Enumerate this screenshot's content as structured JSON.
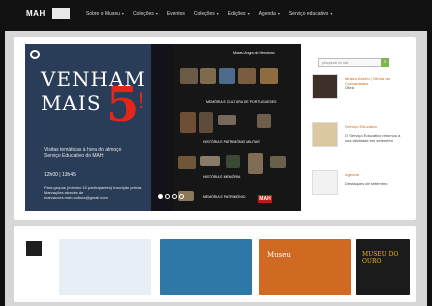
{
  "header": {
    "logo_text": "MAH",
    "nav": [
      {
        "label": "Sobre o Museu",
        "has_menu": true
      },
      {
        "label": "Coleções",
        "has_menu": true
      },
      {
        "label": "Eventos",
        "has_menu": false
      },
      {
        "label": "Coleções",
        "has_menu": true
      },
      {
        "label": "Edições",
        "has_menu": true
      },
      {
        "label": "Agenda",
        "has_menu": true
      },
      {
        "label": "Serviço educativo",
        "has_menu": true
      }
    ]
  },
  "hero": {
    "header_text": "Museu Angra do Heroísmo",
    "title_line1": "VENHAM",
    "title_line2": "MAIS",
    "title_number": "5",
    "title_punctuation": "!",
    "subtitle": "Visitas temáticas à hora do almoço Serviço Educativo do MAH",
    "time": "12h00 | 13h45",
    "note": "Para grupos (mínimo 10 participantes) Inscrição prévia. Marcações através de marcacoes.mah.cultura@gmail.com",
    "captions": [
      {
        "title": "MEMÓRIA E CULTURA DE PORTUGUESES"
      },
      {
        "title": "HISTÓRIA E PATRIMÓNIO MILITAR"
      },
      {
        "title": "HISTÓRIA E MEMÓRIA"
      },
      {
        "title": "MEMÓRIA E PATRIMÓNIO"
      }
    ],
    "brand": "MAH"
  },
  "sidebar": {
    "search_placeholder": "pesquisar no site",
    "cards": [
      {
        "title": "Museu Aberto | Vitrina da Curiosidades",
        "text": "Obra"
      },
      {
        "title": "Serviço Educativo",
        "text": "O Serviço Educativo retomou a sua atividade em setembro"
      },
      {
        "title": "Agenda",
        "text": "Destaques de setembro"
      }
    ]
  },
  "strip": {
    "items": [
      {
        "label": "Museu"
      },
      {
        "label": "MUSEU DO OURO"
      }
    ]
  },
  "colors": {
    "accent": "#e32619",
    "link": "#c86914",
    "search_button": "#7fb44f"
  }
}
